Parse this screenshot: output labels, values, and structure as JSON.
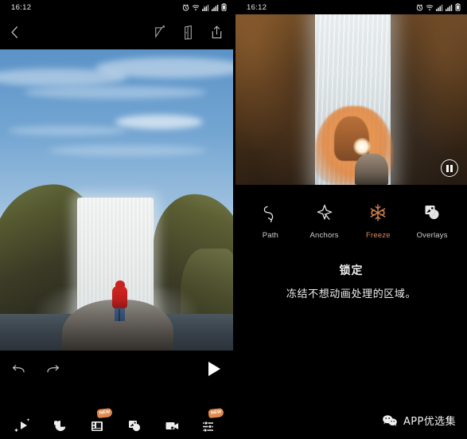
{
  "left_panel": {
    "statusbar": {
      "time": "16:12",
      "icons": [
        "alarm-icon",
        "wifi-icon",
        "signal-1-icon",
        "signal-2-icon",
        "battery-icon"
      ]
    },
    "topbar": {
      "back_icon": "back-chevron-icon",
      "actions": [
        "cursor-select-icon",
        "compare-pages-icon",
        "share-icon"
      ]
    },
    "canvas": {
      "content": "waterfall-photo-with-person-in-red-jacket"
    },
    "playback": {
      "undo_icon": "undo-icon",
      "redo_icon": "redo-icon",
      "play_icon": "play-icon"
    },
    "bottom_tools": [
      {
        "name": "effects",
        "icon": "sparkle-arrow-icon",
        "badge": ""
      },
      {
        "name": "paint",
        "icon": "paint-blob-icon",
        "badge": ""
      },
      {
        "name": "film",
        "icon": "film-strip-icon",
        "badge": "NEW"
      },
      {
        "name": "overlays",
        "icon": "overlays-icon",
        "badge": ""
      },
      {
        "name": "camera",
        "icon": "video-camera-icon",
        "badge": ""
      },
      {
        "name": "adjust",
        "icon": "sliders-icon",
        "badge": "NEW"
      }
    ]
  },
  "right_panel": {
    "statusbar": {
      "time": "16:12",
      "icons": [
        "alarm-icon",
        "wifi-icon",
        "signal-1-icon",
        "signal-2-icon",
        "battery-icon"
      ]
    },
    "preview": {
      "content": "zoomed-waterfall-with-orange-freeze-mask",
      "pause_icon": "pause-icon"
    },
    "tools": [
      {
        "label": "Path",
        "icon": "path-curve-arrow-icon",
        "active": false
      },
      {
        "label": "Anchors",
        "icon": "anchor-star-icon",
        "active": false
      },
      {
        "label": "Freeze",
        "icon": "snowflake-icon",
        "active": true
      },
      {
        "label": "Overlays",
        "icon": "overlays-squares-icon",
        "active": false
      }
    ],
    "help": {
      "title": "锁定",
      "description": "冻结不想动画处理的区域。"
    },
    "watermark": {
      "icon": "wechat-icon",
      "text": "APP优选集"
    }
  },
  "colors": {
    "accent": "#d58a5e",
    "badge": "#e08a4e",
    "background": "#000000",
    "text": "#ededed"
  }
}
